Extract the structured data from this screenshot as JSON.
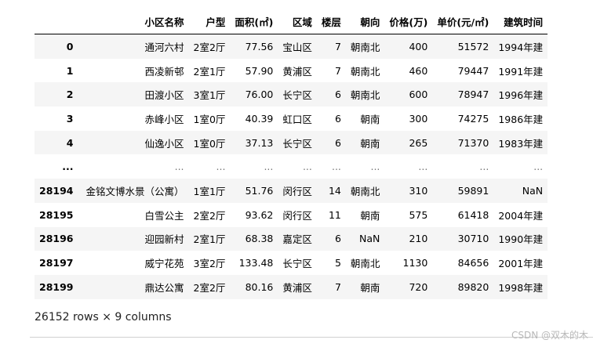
{
  "columns": [
    "小区名称",
    "户型",
    "面积(㎡)",
    "区域",
    "楼层",
    "朝向",
    "价格(万)",
    "单价(元/㎡)",
    "建筑时间"
  ],
  "rows": [
    {
      "index": "0",
      "cells": [
        "通河六村",
        "2室2厅",
        "77.56",
        "宝山区",
        "7",
        "朝南北",
        "400",
        "51572",
        "1994年建"
      ]
    },
    {
      "index": "1",
      "cells": [
        "西凌新邨",
        "2室1厅",
        "57.90",
        "黄浦区",
        "7",
        "朝南北",
        "460",
        "79447",
        "1991年建"
      ]
    },
    {
      "index": "2",
      "cells": [
        "田渡小区",
        "3室1厅",
        "76.00",
        "长宁区",
        "6",
        "朝南北",
        "600",
        "78947",
        "1996年建"
      ]
    },
    {
      "index": "3",
      "cells": [
        "赤峰小区",
        "1室0厅",
        "40.39",
        "虹口区",
        "6",
        "朝南",
        "300",
        "74275",
        "1986年建"
      ]
    },
    {
      "index": "4",
      "cells": [
        "仙逸小区",
        "1室0厅",
        "37.13",
        "长宁区",
        "6",
        "朝南",
        "265",
        "71370",
        "1983年建"
      ]
    },
    {
      "index": "...",
      "cells": [
        "...",
        "...",
        "...",
        "...",
        "...",
        "...",
        "...",
        "...",
        "..."
      ]
    },
    {
      "index": "28194",
      "cells": [
        "金铭文博水景（公寓）",
        "1室1厅",
        "51.76",
        "闵行区",
        "14",
        "朝南北",
        "310",
        "59891",
        "NaN"
      ]
    },
    {
      "index": "28195",
      "cells": [
        "白雪公主",
        "2室2厅",
        "93.62",
        "闵行区",
        "11",
        "朝南",
        "575",
        "61418",
        "2004年建"
      ]
    },
    {
      "index": "28196",
      "cells": [
        "迎园新村",
        "2室1厅",
        "68.38",
        "嘉定区",
        "6",
        "NaN",
        "210",
        "30710",
        "1990年建"
      ]
    },
    {
      "index": "28197",
      "cells": [
        "威宁花苑",
        "3室2厅",
        "133.48",
        "长宁区",
        "5",
        "朝南北",
        "1130",
        "84656",
        "2001年建"
      ]
    },
    {
      "index": "28199",
      "cells": [
        "鼎达公寓",
        "2室2厅",
        "80.16",
        "黄浦区",
        "7",
        "朝南",
        "720",
        "89820",
        "1998年建"
      ]
    }
  ],
  "shape_text": "26152 rows × 9 columns",
  "watermark": "CSDN @双木的木"
}
